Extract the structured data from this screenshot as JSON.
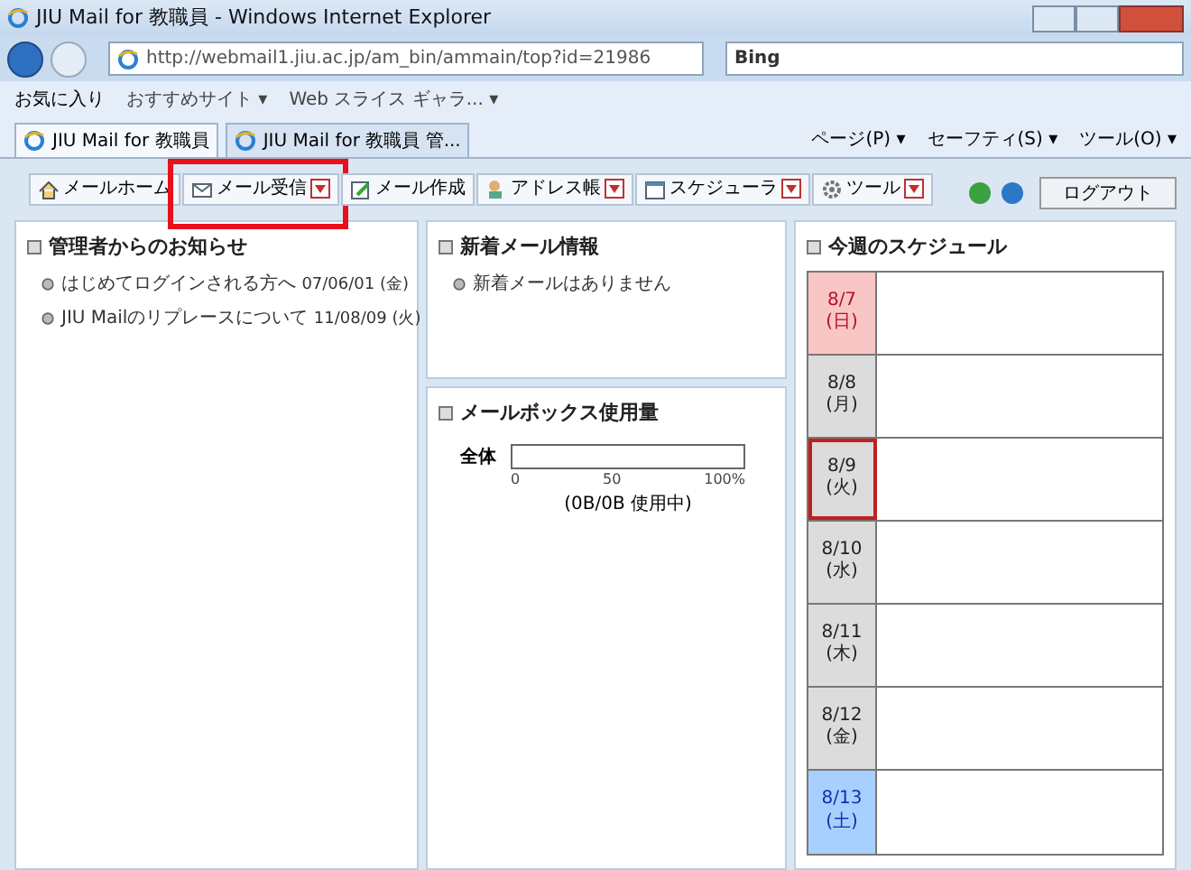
{
  "window": {
    "title": "JIU Mail for 教職員 - Windows Internet Explorer"
  },
  "address_bar": {
    "value": "http://webmail1.jiu.ac.jp/am_bin/ammain/top?id=21986"
  },
  "search": {
    "value": "Bing"
  },
  "favorites_bar": {
    "favorites": "お気に入り",
    "items": [
      "おすすめサイト ▾",
      "Web スライス ギャラ... ▾"
    ]
  },
  "browser_tabs": [
    {
      "label": "JIU Mail for 教職員",
      "selected": true
    },
    {
      "label": "JIU Mail for 教職員 管...",
      "selected": false
    }
  ],
  "command_bar": [
    "ページ(P) ▾",
    "セーフティ(S) ▾",
    "ツール(O) ▾"
  ],
  "app_toolbar": [
    {
      "label": "メールホーム",
      "dropdown": false,
      "highlighted": false
    },
    {
      "label": "メール受信",
      "dropdown": true,
      "highlighted": true
    },
    {
      "label": "メール作成",
      "dropdown": false,
      "highlighted": false
    },
    {
      "label": "アドレス帳",
      "dropdown": true,
      "highlighted": false
    },
    {
      "label": "スケジューラ",
      "dropdown": true,
      "highlighted": false
    },
    {
      "label": "ツール",
      "dropdown": true,
      "highlighted": false
    }
  ],
  "logout": "ログアウト",
  "notices": {
    "title": "管理者からのお知らせ",
    "items": [
      {
        "text": "はじめてログインされる方へ",
        "date": "07/06/01 (金)"
      },
      {
        "text": "JIU Mailのリプレースについて",
        "date": "11/08/09 (火)"
      }
    ]
  },
  "new_mail": {
    "title": "新着メール情報",
    "items": [
      "新着メールはありません"
    ]
  },
  "mailbox_usage": {
    "title": "メールボックス使用量",
    "label": "全体",
    "level": 0,
    "ticks": [
      "0",
      "50",
      "100%"
    ],
    "usage": "(0B/0B 使用中)"
  },
  "schedule": {
    "title": "今週のスケジュール",
    "days": [
      {
        "date": "8/7",
        "weekday": "(日)",
        "kind": "sunday",
        "selected": false
      },
      {
        "date": "8/8",
        "weekday": "(月)",
        "kind": "weekday",
        "selected": false
      },
      {
        "date": "8/9",
        "weekday": "(火)",
        "kind": "weekday",
        "selected": true
      },
      {
        "date": "8/10",
        "weekday": "(水)",
        "kind": "weekday",
        "selected": false
      },
      {
        "date": "8/11",
        "weekday": "(木)",
        "kind": "weekday",
        "selected": false
      },
      {
        "date": "8/12",
        "weekday": "(金)",
        "kind": "weekday",
        "selected": false
      },
      {
        "date": "8/13",
        "weekday": "(土)",
        "kind": "saturday",
        "selected": false
      }
    ]
  }
}
